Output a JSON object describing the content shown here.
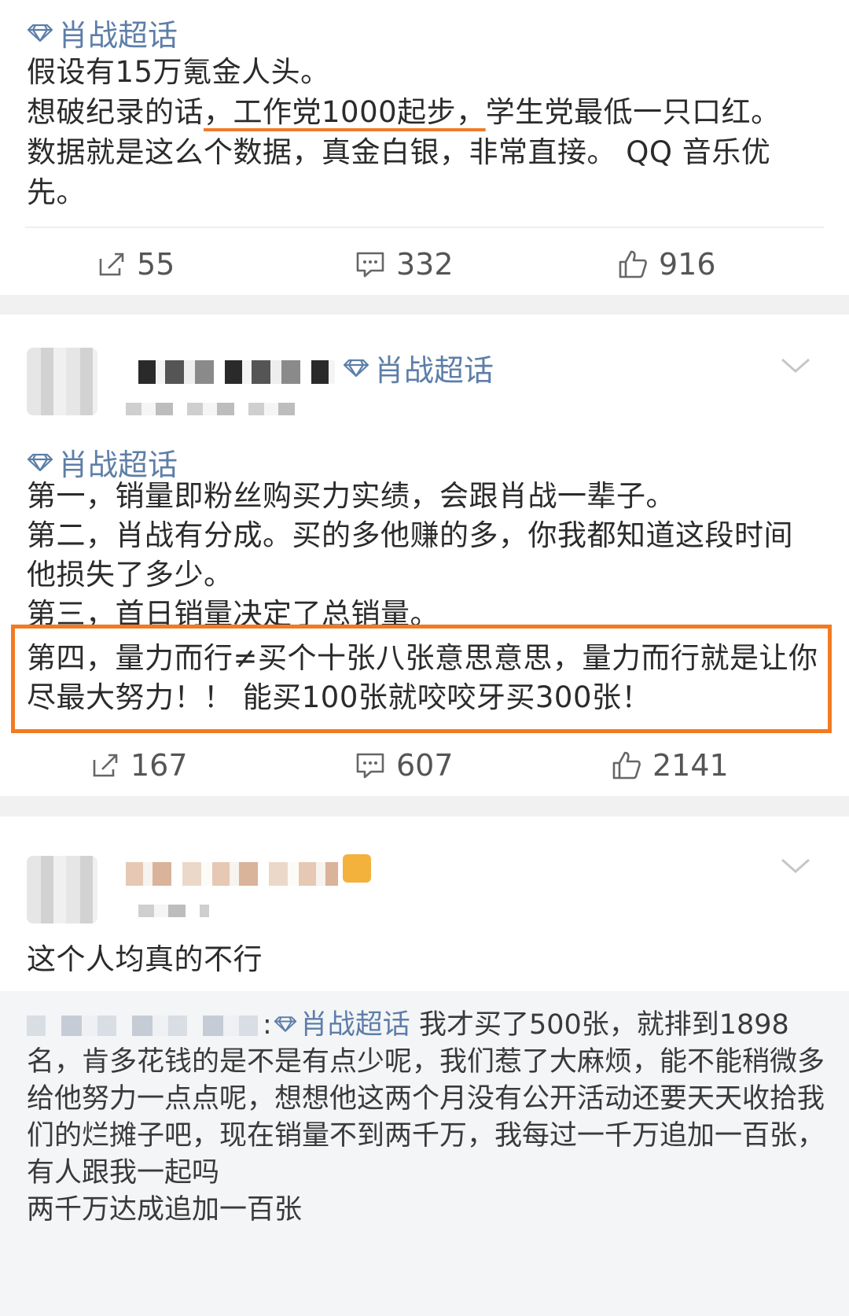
{
  "post1": {
    "tag": "肖战超话",
    "lines": [
      "假设有15万氪金人头。",
      "想破纪录的话",
      "，工作党1000起步，",
      "学生党最低一只口红。",
      "数据就是这么个数据，真金白银，非常直接。 QQ 音乐优先。"
    ],
    "actions": {
      "repost": "55",
      "comment": "332",
      "like": "916"
    }
  },
  "post2": {
    "header_tag": "肖战超话",
    "tag": "肖战超话",
    "lines": [
      "第一，销量即粉丝购买力实绩，会跟肖战一辈子。",
      "第二，肖战有分成。买的多他赚的多，你我都知道这段时间他损失了多少。",
      "第三，首日销量决定了总销量。",
      "第四，量力而行≠买个十张八张意思意思，量力而行就是让你尽最大努力！！ 能买100张就咬咬牙买300张！"
    ],
    "actions": {
      "repost": "167",
      "comment": "607",
      "like": "2141"
    }
  },
  "post3": {
    "text": "这个人均真的不行",
    "reply": {
      "sep": ":",
      "tag": "肖战超话",
      "text": " 我才买了500张，就排到1898名，肯多花钱的是不是有点少呢，我们惹了大麻烦，能不能稍微多给他努力一点点呢，想想他这两个月没有公开活动还要天天收拾我们的烂摊子吧，现在销量不到两千万，我每过一千万追加一百张，有人跟我一起吗",
      "line2": "两千万达成追加一百张"
    }
  },
  "colors": {
    "link": "#5d7ea8",
    "highlight": "#f27a22",
    "underline": "#ef7a2b"
  }
}
